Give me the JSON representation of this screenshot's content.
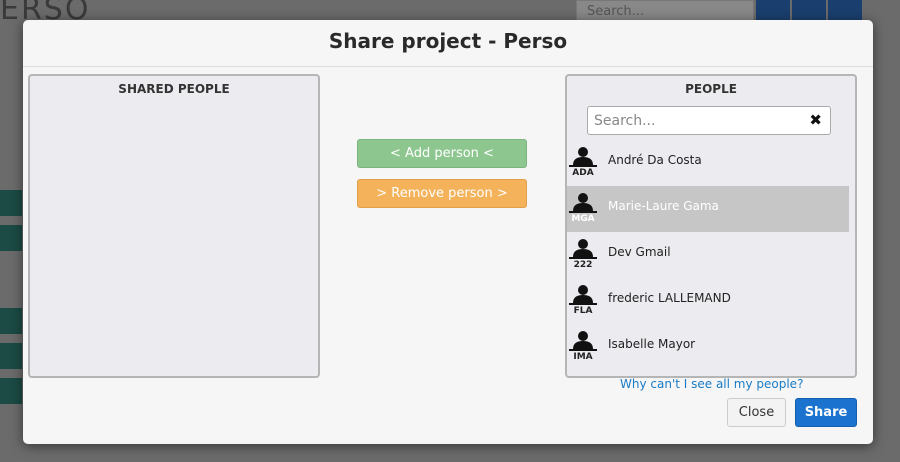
{
  "background": {
    "logo_text": "ERSO",
    "search_placeholder": "Search..."
  },
  "modal": {
    "title": "Share project - Perso",
    "shared_panel": {
      "title": "SHARED PEOPLE"
    },
    "people_panel": {
      "title": "PEOPLE",
      "search_placeholder": "Search...",
      "clear_glyph": "✖",
      "people": [
        {
          "initials": "ADA",
          "name": "André Da Costa",
          "selected": false
        },
        {
          "initials": "MGA",
          "name": "Marie-Laure Gama",
          "selected": true
        },
        {
          "initials": "222",
          "name": "Dev Gmail",
          "selected": false
        },
        {
          "initials": "FLA",
          "name": "frederic LALLEMAND",
          "selected": false
        },
        {
          "initials": "IMA",
          "name": "Isabelle Mayor",
          "selected": false
        }
      ]
    },
    "add_label": "< Add person <",
    "remove_label": "> Remove person >",
    "help_link": "Why can't I see all my people?",
    "close_label": "Close",
    "share_label": "Share"
  },
  "colors": {
    "add_button": "#8dc78f",
    "remove_button": "#f4b25a",
    "share_button": "#1b73cf",
    "link": "#1a7bc4",
    "selected_row": "#c6c6c6"
  }
}
